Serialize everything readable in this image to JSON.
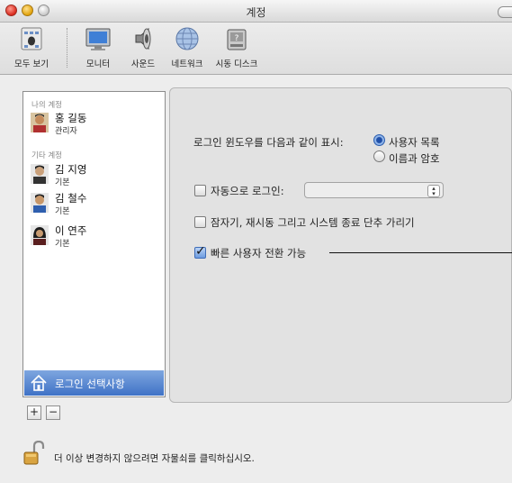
{
  "window": {
    "title": "계정"
  },
  "toolbar": {
    "items": [
      {
        "label": "모두 보기",
        "icon": "show-all-icon"
      },
      {
        "label": "모니터",
        "icon": "monitor-icon"
      },
      {
        "label": "사운드",
        "icon": "sound-icon"
      },
      {
        "label": "네트워크",
        "icon": "network-icon"
      },
      {
        "label": "시동 디스크",
        "icon": "startup-disk-icon"
      }
    ]
  },
  "accounts": {
    "my_account_header": "나의 계정",
    "my_account": {
      "name": "홍 길동",
      "role": "관리자"
    },
    "other_accounts_header": "기타 계정",
    "others": [
      {
        "name": "김 지영",
        "role": "기본"
      },
      {
        "name": "김 철수",
        "role": "기본"
      },
      {
        "name": "이 연주",
        "role": "기본"
      }
    ],
    "login_options_label": "로그인 선택사항",
    "add_label": "+",
    "remove_label": "−"
  },
  "login_options": {
    "display_label": "로그인 윈도우를 다음과 같이 표시:",
    "radio_list": "사용자 목록",
    "radio_name_password": "이름과 암호",
    "auto_login_label": "자동으로 로그인:",
    "auto_login_value": "",
    "hide_buttons_label": "잠자기, 재시동 그리고 시스템 종료 단추 가리기",
    "fast_switch_label": "빠른 사용자 전환 가능",
    "fast_switch_checked": true,
    "radio_selected": "사용자 목록"
  },
  "lock": {
    "text": "더 이상 변경하지 않으려면 자물쇠를 클릭하십시오."
  }
}
